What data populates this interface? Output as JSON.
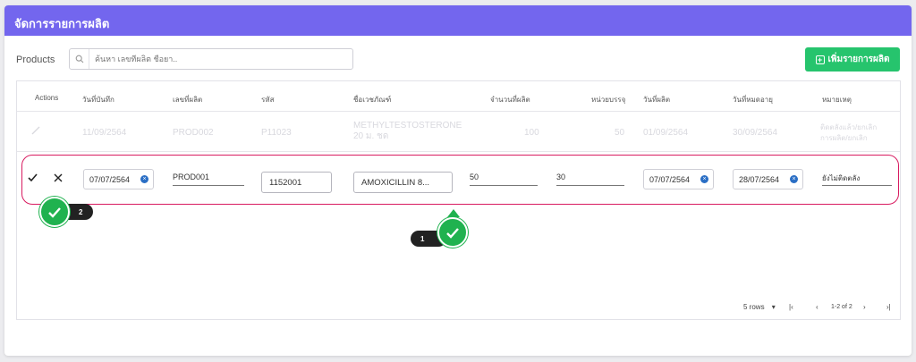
{
  "header": {
    "title": "จัดการรายการผลิต"
  },
  "toolbar": {
    "label": "Products",
    "search_placeholder": "ค้นหา เลขที่ผลิต ชื่อยา..",
    "add_button": "เพิ่มรายการผลิต"
  },
  "table": {
    "columns": [
      "Actions",
      "วันที่บันทึก",
      "เลขที่ผลิต",
      "รหัส",
      "ชื่อเวชภัณฑ์",
      "จำนวนที่ผลิต",
      "หน่วยบรรจุ",
      "วันที่ผลิต",
      "วันที่หมดอายุ",
      "หมายเหตุ"
    ],
    "faded_row": {
      "date": "11/09/2564",
      "lot": "PROD002",
      "code": "P11023",
      "name_line1": "METHYLTESTOSTERONE",
      "name_line2": "20 ม. ชด",
      "qty": "100",
      "pack": "50",
      "mfg": "01/09/2564",
      "exp": "30/09/2564",
      "note_line1": "ติดตลังแล้ว/ยกเลิก",
      "note_line2": "การผลิต/ยกเลิก"
    },
    "edit_row": {
      "save_icon": "check-icon",
      "cancel_icon": "close-icon",
      "date": "07/07/2564",
      "lot": "PROD001",
      "code": "1152001",
      "name": "AMOXICILLIN 8...",
      "qty": "50",
      "pack": "30",
      "mfg": "07/07/2564",
      "exp": "28/07/2564",
      "note": "ยังไม่ติดตลัง"
    }
  },
  "steps": [
    {
      "number": "1"
    },
    {
      "number": "2"
    }
  ],
  "pagination": {
    "rows_per_page": "5 rows",
    "range": "1-2 of 2"
  },
  "colors": {
    "header": "#7366ee",
    "accent_green": "#26c46d",
    "highlight": "#d81b60"
  }
}
